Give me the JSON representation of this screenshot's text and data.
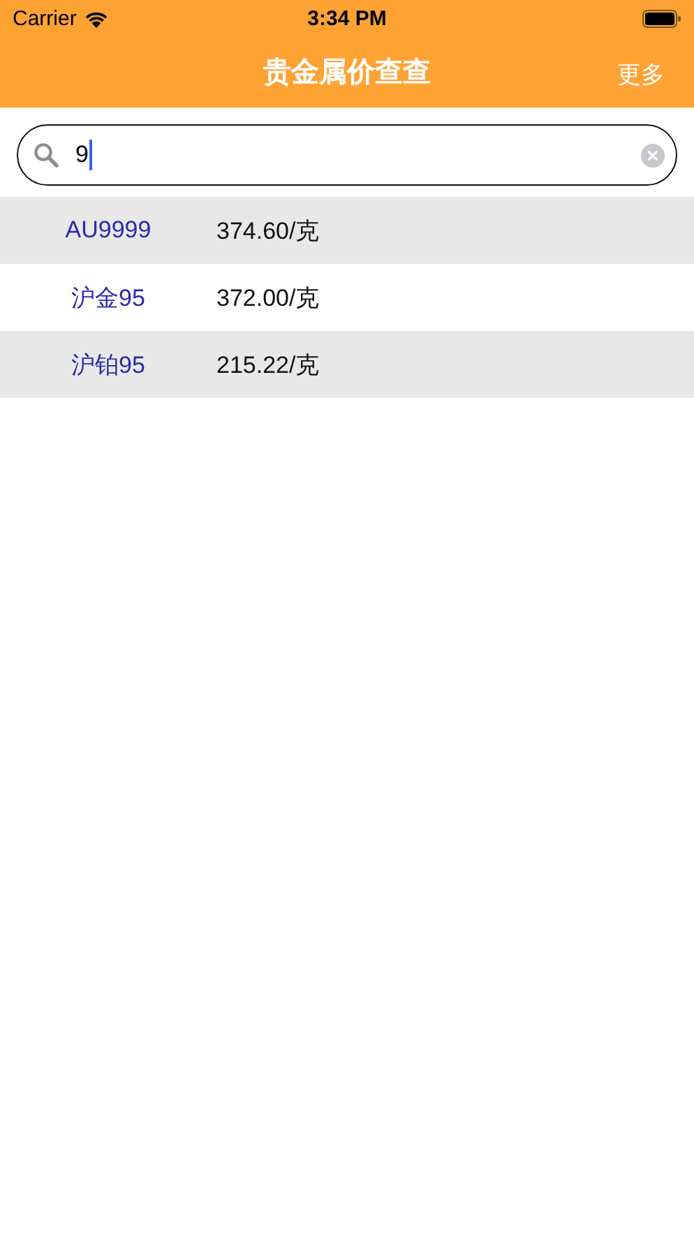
{
  "status_bar": {
    "carrier": "Carrier",
    "time": "3:34 PM"
  },
  "nav_bar": {
    "title": "贵金属价查查",
    "right_button": "更多"
  },
  "search": {
    "value": "9"
  },
  "rows": [
    {
      "name": "AU9999",
      "price": "374.60/克"
    },
    {
      "name": "沪金95",
      "price": "372.00/克"
    },
    {
      "name": "沪铂95",
      "price": "215.22/克"
    }
  ]
}
